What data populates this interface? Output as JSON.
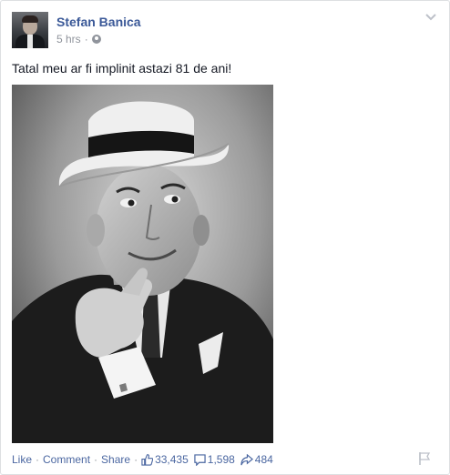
{
  "post": {
    "author": "Stefan Banica",
    "time": "5 hrs",
    "separator": "·",
    "text": "Tatal meu ar fi implinit astazi 81 de ani!"
  },
  "icons": {
    "privacy": "globe-icon",
    "options": "chevron-down-icon",
    "like": "thumbs-up-icon",
    "comment": "comment-bubble-icon",
    "share": "share-arrow-icon",
    "report": "flag-icon"
  },
  "actions": {
    "like": "Like",
    "comment": "Comment",
    "share": "Share",
    "dot": "·",
    "likes_count": "33,435",
    "comments_count": "1,598",
    "shares_count": "484"
  },
  "colors": {
    "link": "#3b5998",
    "meta": "#90949c",
    "border": "#dddfe2"
  }
}
